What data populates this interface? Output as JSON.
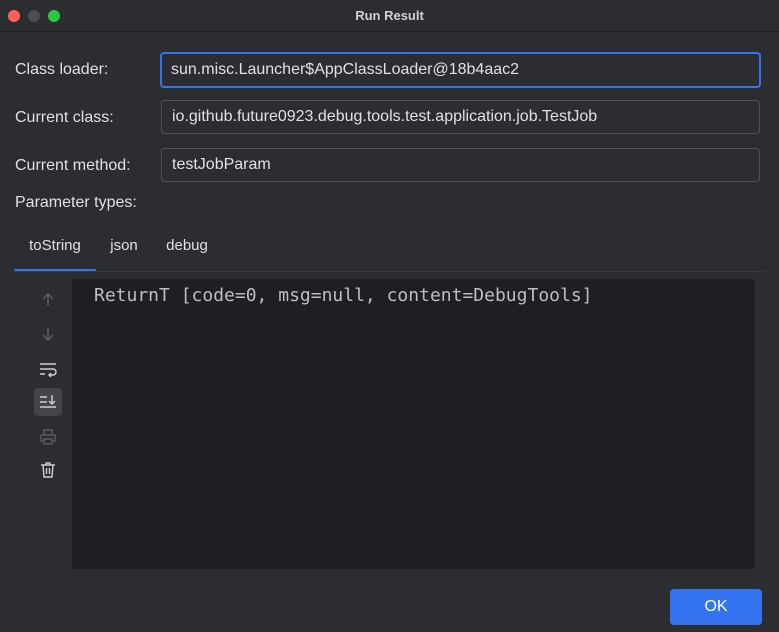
{
  "window": {
    "title": "Run Result"
  },
  "form": {
    "class_loader_label": "Class loader:",
    "class_loader_value": "sun.misc.Launcher$AppClassLoader@18b4aac2",
    "current_class_label": "Current class:",
    "current_class_value": "io.github.future0923.debug.tools.test.application.job.TestJob",
    "current_method_label": "Current method:",
    "current_method_value": "testJobParam",
    "parameter_types_label": "Parameter types:"
  },
  "tabs": [
    {
      "label": "toString",
      "active": true
    },
    {
      "label": "json",
      "active": false
    },
    {
      "label": "debug",
      "active": false
    }
  ],
  "toolbar": {
    "icons": [
      "arrow-up-icon",
      "arrow-down-icon",
      "soft-wrap-icon",
      "scroll-to-end-icon",
      "print-icon",
      "trash-icon"
    ]
  },
  "console": {
    "output": "ReturnT [code=0, msg=null, content=DebugTools]"
  },
  "footer": {
    "ok_label": "OK"
  },
  "colors": {
    "accent": "#3574f0",
    "background": "#2b2d30",
    "console_background": "#1e1f22"
  }
}
